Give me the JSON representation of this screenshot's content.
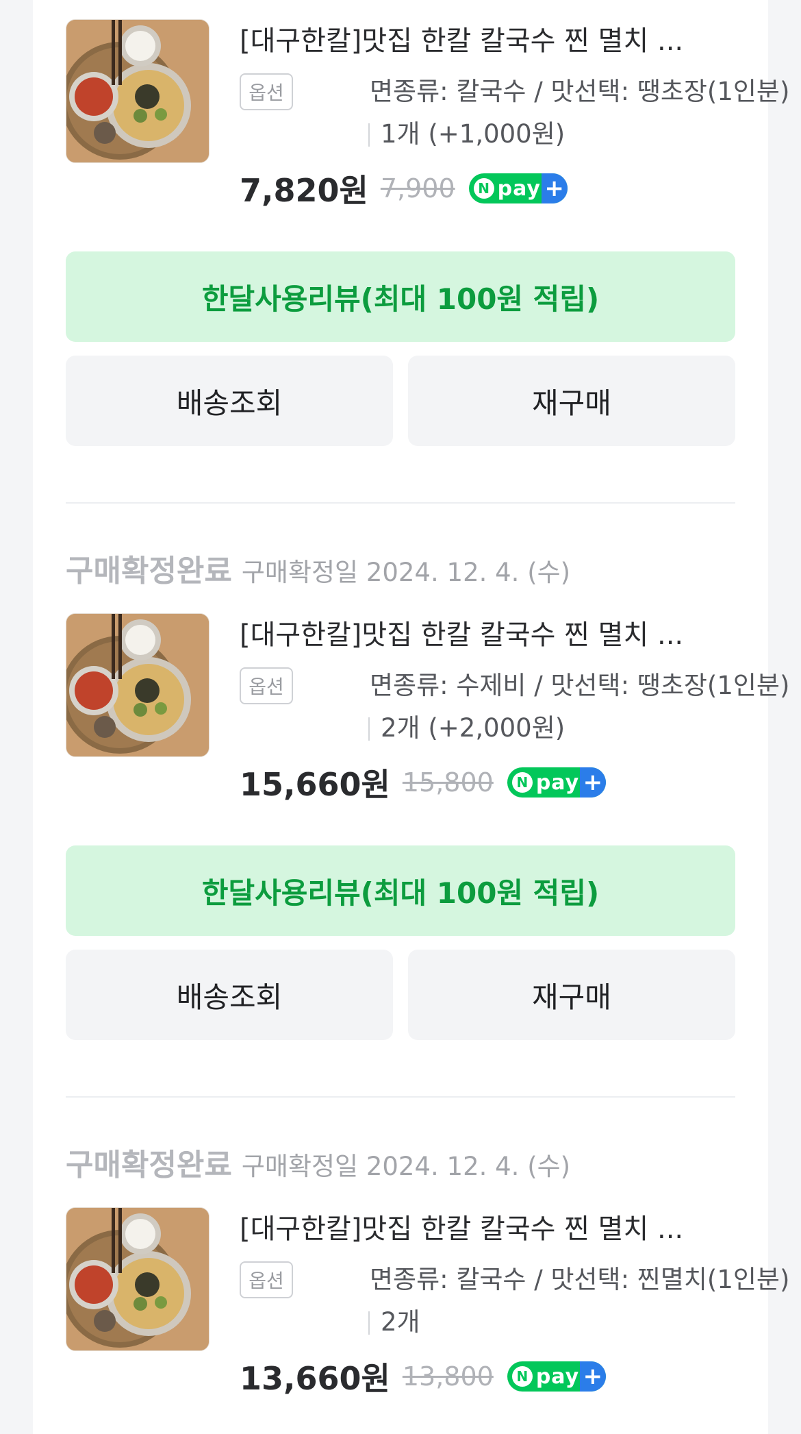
{
  "orders": [
    {
      "status": "",
      "confirm_date": "",
      "product_title": "[대구한칼]맛집 한칼 칼국수 찐 멸치 ...",
      "option_tag": "옵션",
      "option_text": "면종류: 칼국수 / 맛선택: 땡초장(1인분)",
      "quantity": "1개 (+1,000원)",
      "price": "7,820원",
      "original_price": "7,900",
      "npay_badge": "pay",
      "review_button": "한달사용리뷰(최대 100원 적립)",
      "delivery_button": "배송조회",
      "rebuy_button": "재구매"
    },
    {
      "status": "구매확정완료",
      "confirm_date": "구매확정일 2024. 12. 4. (수)",
      "product_title": "[대구한칼]맛집 한칼 칼국수 찐 멸치 ...",
      "option_tag": "옵션",
      "option_text": "면종류: 수제비 / 맛선택: 땡초장(1인분)",
      "quantity": "2개 (+2,000원)",
      "price": "15,660원",
      "original_price": "15,800",
      "npay_badge": "pay",
      "review_button": "한달사용리뷰(최대 100원 적립)",
      "delivery_button": "배송조회",
      "rebuy_button": "재구매"
    },
    {
      "status": "구매확정완료",
      "confirm_date": "구매확정일 2024. 12. 4. (수)",
      "product_title": "[대구한칼]맛집 한칼 칼국수 찐 멸치 ...",
      "option_tag": "옵션",
      "option_text": "면종류: 칼국수 / 맛선택: 찐멸치(1인분)",
      "quantity": "2개",
      "price": "13,660원",
      "original_price": "13,800",
      "npay_badge": "pay"
    }
  ],
  "colors": {
    "review_bg": "#d5f6df",
    "review_text": "#0c9c3e",
    "npay_green": "#03c75a",
    "npay_blue": "#2b7de9"
  },
  "icons": [
    "product-thumbnail-image",
    "npay-plus-badge-icon"
  ]
}
